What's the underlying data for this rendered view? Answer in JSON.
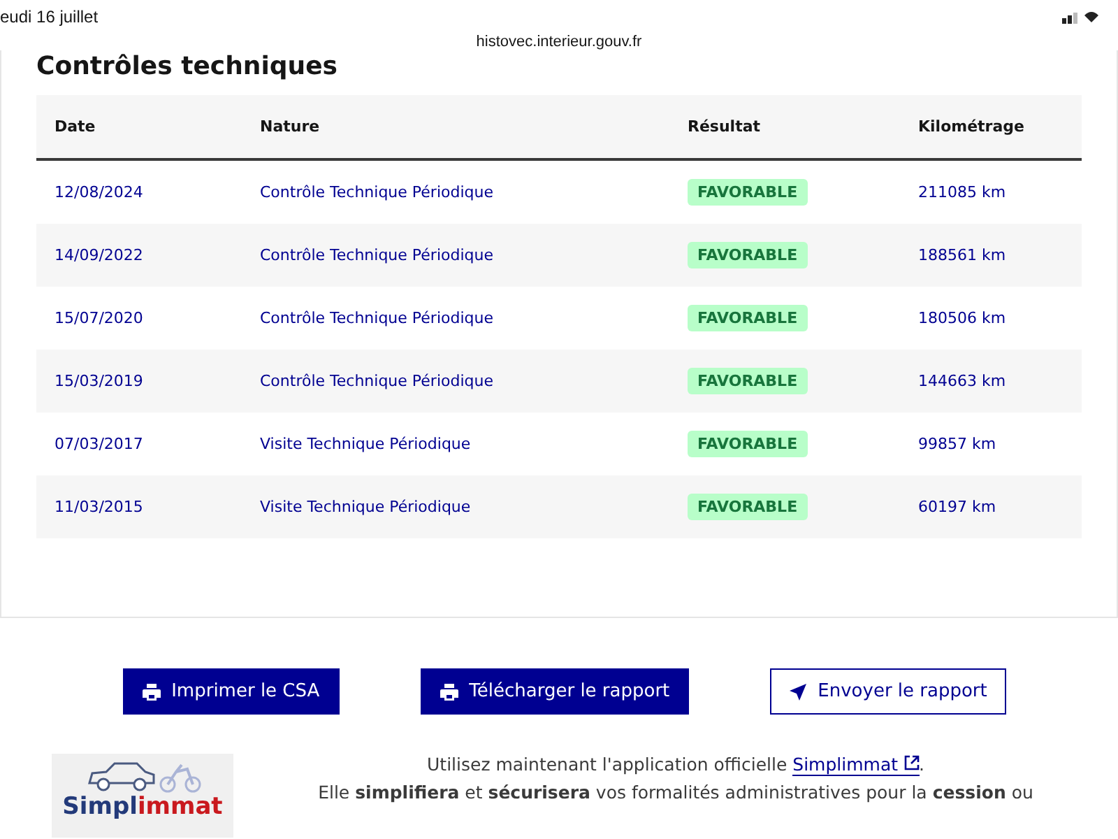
{
  "status_bar": {
    "time": "eudi 16 juillet"
  },
  "address_bar": {
    "url": "histovec.interieur.gouv.fr"
  },
  "section": {
    "title": "Contrôles techniques"
  },
  "table": {
    "columns": [
      "Date",
      "Nature",
      "Résultat",
      "Kilométrage"
    ],
    "rows": [
      {
        "date": "12/08/2024",
        "nature": "Contrôle Technique Périodique",
        "result": "FAVORABLE",
        "km": "211085 km"
      },
      {
        "date": "14/09/2022",
        "nature": "Contrôle Technique Périodique",
        "result": "FAVORABLE",
        "km": "188561 km"
      },
      {
        "date": "15/07/2020",
        "nature": "Contrôle Technique Périodique",
        "result": "FAVORABLE",
        "km": "180506 km"
      },
      {
        "date": "15/03/2019",
        "nature": "Contrôle Technique Périodique",
        "result": "FAVORABLE",
        "km": "144663 km"
      },
      {
        "date": "07/03/2017",
        "nature": "Visite Technique Périodique",
        "result": "FAVORABLE",
        "km": "99857 km"
      },
      {
        "date": "11/03/2015",
        "nature": "Visite Technique Périodique",
        "result": "FAVORABLE",
        "km": "60197 km"
      }
    ]
  },
  "actions": [
    {
      "label": "Imprimer le CSA",
      "kind": "print"
    },
    {
      "label": "Télécharger le rapport",
      "kind": "print"
    },
    {
      "label": "Envoyer le rapport",
      "kind": "send"
    }
  ],
  "promo": {
    "logo_part1": "Simpl",
    "logo_part2": "immat",
    "intro": "Utilisez maintenant l'application officielle",
    "link": "Simplimmat",
    "after_link": ".",
    "text": "Elle **simplifiera** et **sécurisera** vos formalités administratives pour la **cession** ou"
  }
}
